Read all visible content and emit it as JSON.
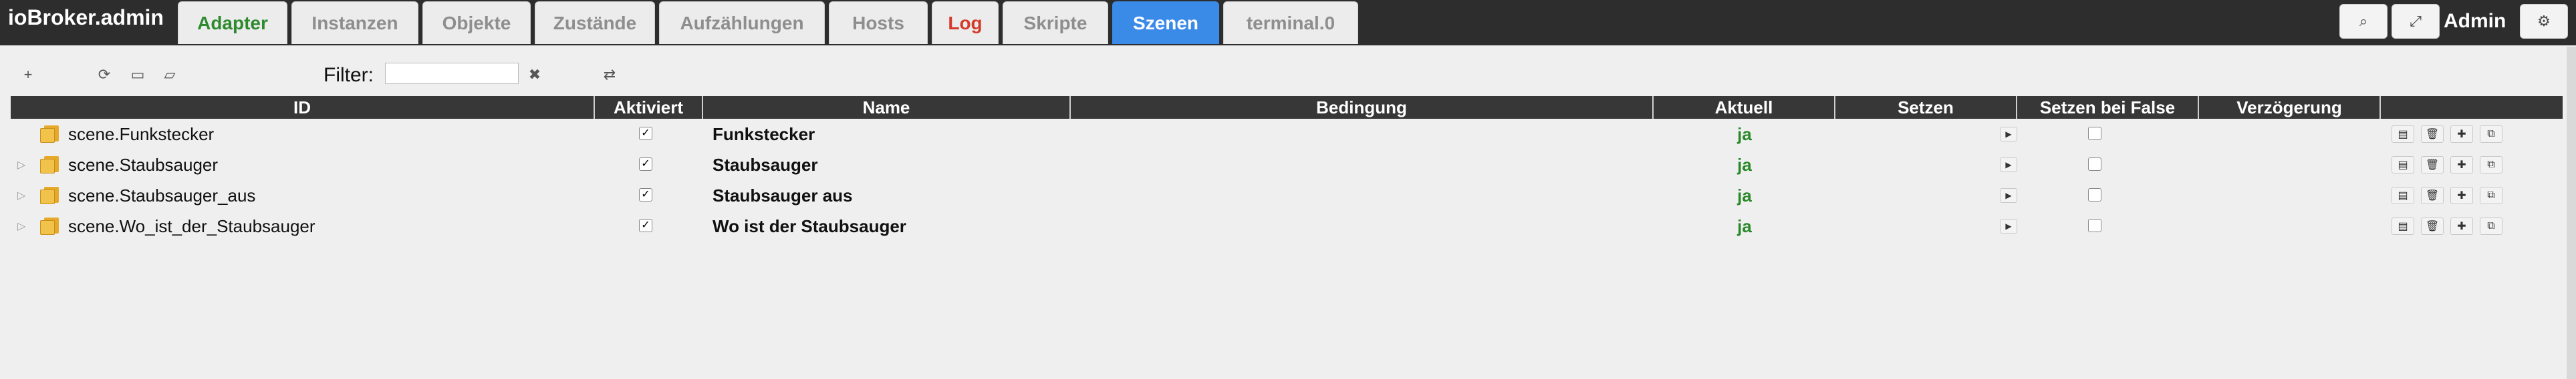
{
  "app_title": "ioBroker.admin",
  "tabs": [
    {
      "label": "Adapter",
      "style": "green"
    },
    {
      "label": "Instanzen",
      "style": "normal"
    },
    {
      "label": "Objekte",
      "style": "normal"
    },
    {
      "label": "Zustände",
      "style": "normal"
    },
    {
      "label": "Aufzählungen",
      "style": "normal"
    },
    {
      "label": "Hosts",
      "style": "normal"
    },
    {
      "label": "Log",
      "style": "red"
    },
    {
      "label": "Skripte",
      "style": "normal"
    },
    {
      "label": "Szenen",
      "style": "active"
    },
    {
      "label": "terminal.0",
      "style": "normal"
    }
  ],
  "user": "Admin",
  "toolbar": {
    "filter_label": "Filter:",
    "filter_value": ""
  },
  "columns": [
    "ID",
    "Aktiviert",
    "Name",
    "Bedingung",
    "Aktuell",
    "Setzen",
    "Setzen bei False",
    "Verzögerung",
    ""
  ],
  "rows": [
    {
      "id": "scene.Funkstecker",
      "activated": true,
      "name": "Funkstecker",
      "condition": "",
      "current": "ja",
      "expandable": false
    },
    {
      "id": "scene.Staubsauger",
      "activated": true,
      "name": "Staubsauger",
      "condition": "",
      "current": "ja",
      "expandable": true
    },
    {
      "id": "scene.Staubsauger_aus",
      "activated": true,
      "name": "Staubsauger aus",
      "condition": "",
      "current": "ja",
      "expandable": true
    },
    {
      "id": "scene.Wo_ist_der_Staubsauger",
      "activated": true,
      "name": "Wo ist der Staubsauger",
      "condition": "",
      "current": "ja",
      "expandable": true
    }
  ],
  "colors": {
    "green": "#2f8a2f",
    "red": "#d43a2a",
    "active_tab": "#3a8ae8",
    "header": "#373737"
  }
}
